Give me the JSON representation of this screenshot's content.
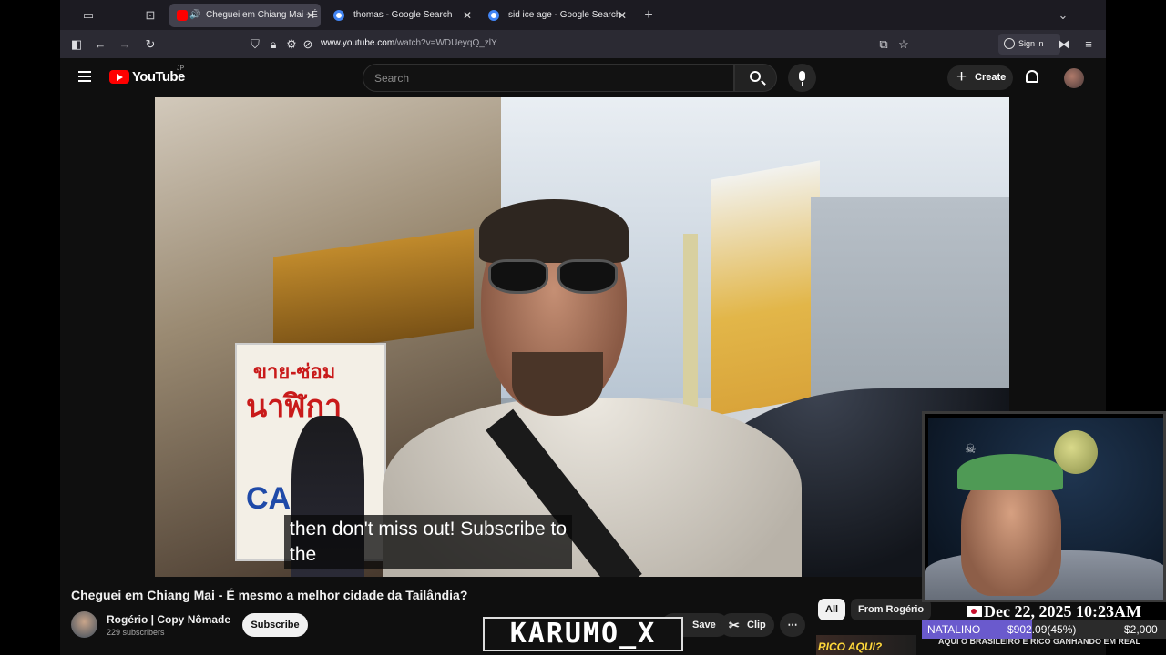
{
  "browser": {
    "tabs": [
      {
        "title": "Cheguei em Chiang Mai - É",
        "active": true
      },
      {
        "title": "thomas - Google Search",
        "active": false
      },
      {
        "title": "sid ice age - Google Search",
        "active": false
      }
    ],
    "new_tab": "+",
    "url_domain": "www.youtube.com",
    "url_path": "/watch?v=WDUeyqQ_zlY",
    "sign_in": "Sign in"
  },
  "youtube": {
    "logo": "YouTube",
    "region": "JP",
    "search_placeholder": "Search",
    "create_label": "Create",
    "video": {
      "caption_line1": "then don't miss out!  Subscribe to",
      "caption_line2": "the",
      "sign_text_1": "ขาย-ซ่อม",
      "sign_text_2": "นาฬิกา",
      "sign_text_3": "CA O"
    },
    "title": "Cheguei em Chiang Mai - É mesmo a melhor cidade da Tailândia?",
    "channel": {
      "name": "Rogério | Copy Nômade",
      "subscribers": "229 subscribers",
      "subscribe_label": "Subscribe"
    },
    "actions": {
      "save": "Save",
      "clip": "Clip",
      "more": "⋯"
    },
    "chips": {
      "all": "All",
      "from_channel": "From Rogério"
    },
    "related_title_1": "RICO AQUI?",
    "related_title_2": "AQUI O BRASILEIRO É RICO GANHANDO EM REAL"
  },
  "overlay": {
    "watermark": "KARUMO_X",
    "datetime": "Dec 22, 2025 10:23AM",
    "goal_name": "NATALINO",
    "goal_amount": "$902.09(45%)",
    "goal_target": "$2,000",
    "goal_percent": 45
  },
  "colors": {
    "youtube_red": "#ff0000",
    "goal_fill": "#6a5acd"
  }
}
